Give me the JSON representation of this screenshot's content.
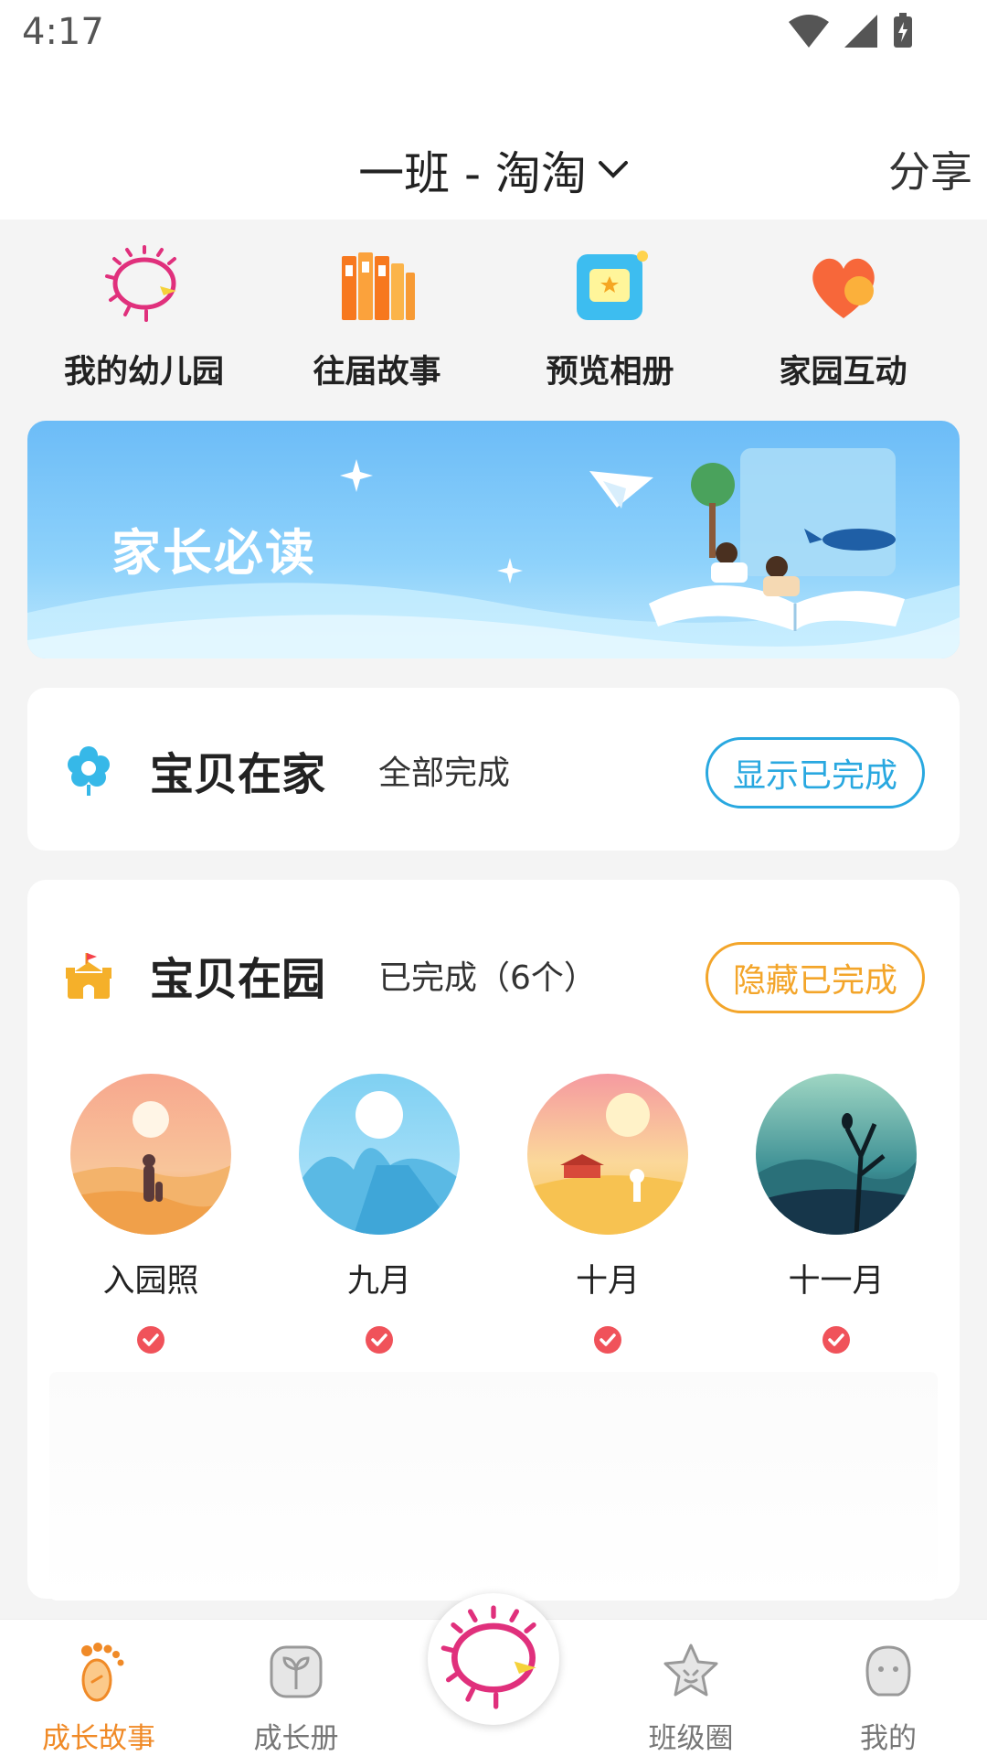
{
  "status": {
    "time": "4:17"
  },
  "header": {
    "title": "一班 - 淘淘",
    "share_label": "分享"
  },
  "quick_links": [
    {
      "label": "我的幼儿园",
      "icon": "kindergarten-logo-icon"
    },
    {
      "label": "往届故事",
      "icon": "books-icon"
    },
    {
      "label": "预览相册",
      "icon": "album-icon"
    },
    {
      "label": "家园互动",
      "icon": "heart-chat-icon"
    }
  ],
  "banner": {
    "title": "家长必读"
  },
  "home_section": {
    "title": "宝贝在家",
    "status": "全部完成",
    "toggle_label": "显示已完成"
  },
  "garden_section": {
    "title": "宝贝在园",
    "status": "已完成（6个）",
    "toggle_label": "隐藏已完成",
    "months": [
      {
        "label": "入园照",
        "done": true
      },
      {
        "label": "九月",
        "done": true
      },
      {
        "label": "十月",
        "done": true
      },
      {
        "label": "十一月",
        "done": true
      }
    ]
  },
  "tabs": [
    {
      "label": "成长故事",
      "active": true
    },
    {
      "label": "成长册",
      "active": false
    },
    {
      "label": "",
      "active": false
    },
    {
      "label": "班级圈",
      "active": false
    },
    {
      "label": "我的",
      "active": false
    }
  ],
  "colors": {
    "accent_orange": "#f08a27",
    "accent_blue": "#29a8e0",
    "check_red": "#f0525a"
  }
}
